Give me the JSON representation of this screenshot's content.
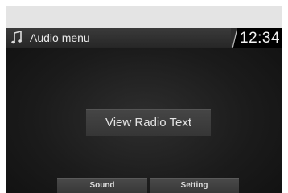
{
  "header": {
    "title": "Audio menu",
    "icon": "music-note-icon",
    "clock": "12:34"
  },
  "main": {
    "view_radio_text_label": "View Radio Text"
  },
  "bottom_bar": {
    "sound_label": "Sound",
    "setting_label": "Setting"
  },
  "colors": {
    "background": "#1b1b1b",
    "header": "#2e2e2e",
    "clock_background": "#000000",
    "text": "#e8e8e8"
  }
}
